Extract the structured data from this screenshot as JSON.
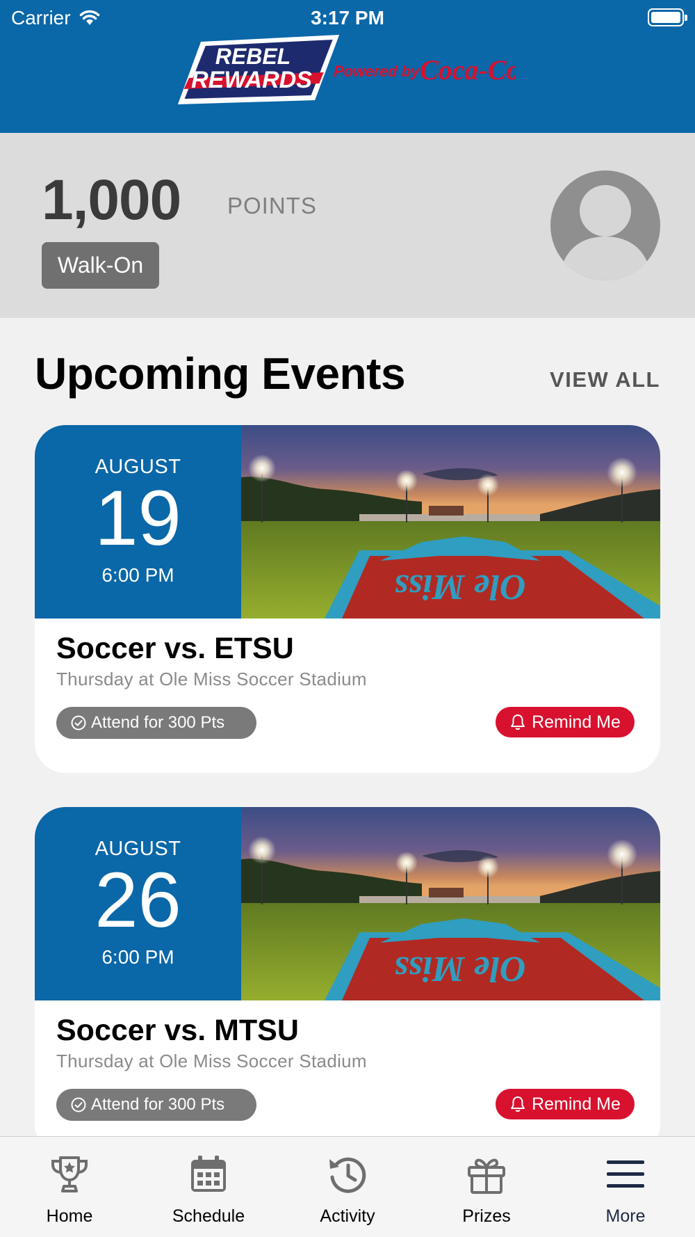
{
  "status_bar": {
    "carrier": "Carrier",
    "time": "3:17 PM"
  },
  "header": {
    "logo_line1": "REBEL",
    "logo_line2": "REWARDS",
    "powered_by": "Powered by",
    "sponsor": "Coca-Cola"
  },
  "points": {
    "value": "1,000",
    "label": "POINTS",
    "level": "Walk-On"
  },
  "events_section": {
    "title": "Upcoming Events",
    "view_all": "VIEW ALL"
  },
  "events": [
    {
      "month": "AUGUST",
      "day": "19",
      "time": "6:00 PM",
      "title": "Soccer vs. ETSU",
      "venue": "Thursday at Ole Miss Soccer Stadium",
      "attend_label": "Attend for 300 Pts",
      "remind_label": "Remind Me"
    },
    {
      "month": "AUGUST",
      "day": "26",
      "time": "6:00 PM",
      "title": "Soccer vs. MTSU",
      "venue": "Thursday at Ole Miss Soccer Stadium",
      "attend_label": "Attend for 300 Pts",
      "remind_label": "Remind Me"
    }
  ],
  "tab_bar": {
    "items": [
      {
        "label": "Home",
        "icon": "trophy-icon"
      },
      {
        "label": "Schedule",
        "icon": "calendar-icon"
      },
      {
        "label": "Activity",
        "icon": "history-icon"
      },
      {
        "label": "Prizes",
        "icon": "gift-icon"
      },
      {
        "label": "More",
        "icon": "menu-icon"
      }
    ]
  },
  "colors": {
    "primary_blue": "#0a67a8",
    "accent_red": "#d8112e",
    "panel_gray": "#dcdcdc",
    "background": "#f1f1f1"
  }
}
